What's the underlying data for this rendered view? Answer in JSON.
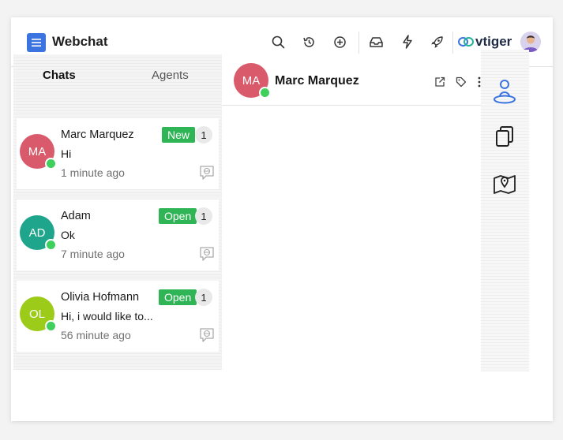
{
  "app": {
    "title": "Webchat",
    "brand": "vtiger"
  },
  "colors": {
    "accent": "#3b73e0",
    "online": "#3ecf5d",
    "badge": "#2fb456"
  },
  "tabs": [
    {
      "label": "Chats",
      "active": true
    },
    {
      "label": "Agents",
      "active": false
    }
  ],
  "chats": [
    {
      "initials": "MA",
      "name": "Marc Marquez",
      "message": "Hi",
      "time": "1 minute ago",
      "status": "New",
      "count": "1",
      "avatar_color": "#d95a6a"
    },
    {
      "initials": "AD",
      "name": "Adam",
      "message": "Ok",
      "time": "7 minute ago",
      "status": "Open",
      "count": "1",
      "avatar_color": "#1ea58c"
    },
    {
      "initials": "OL",
      "name": "Olivia Hofmann",
      "message": "Hi, i would like to...",
      "time": "56 minute ago",
      "status": "Open",
      "count": "1",
      "avatar_color": "#9ccb1a"
    }
  ],
  "conversation": {
    "initials": "MA",
    "name": "Marc Marquez"
  },
  "icons": {
    "topbar": [
      "menu-icon",
      "search-icon",
      "history-icon",
      "add-icon",
      "inbox-icon",
      "flash-icon",
      "rocket-icon",
      "vtiger-logo",
      "user-avatar"
    ],
    "header": [
      "open-external-icon",
      "tag-icon",
      "more-icon"
    ],
    "sidebar": [
      "contact-icon",
      "documents-icon",
      "map-icon"
    ]
  }
}
